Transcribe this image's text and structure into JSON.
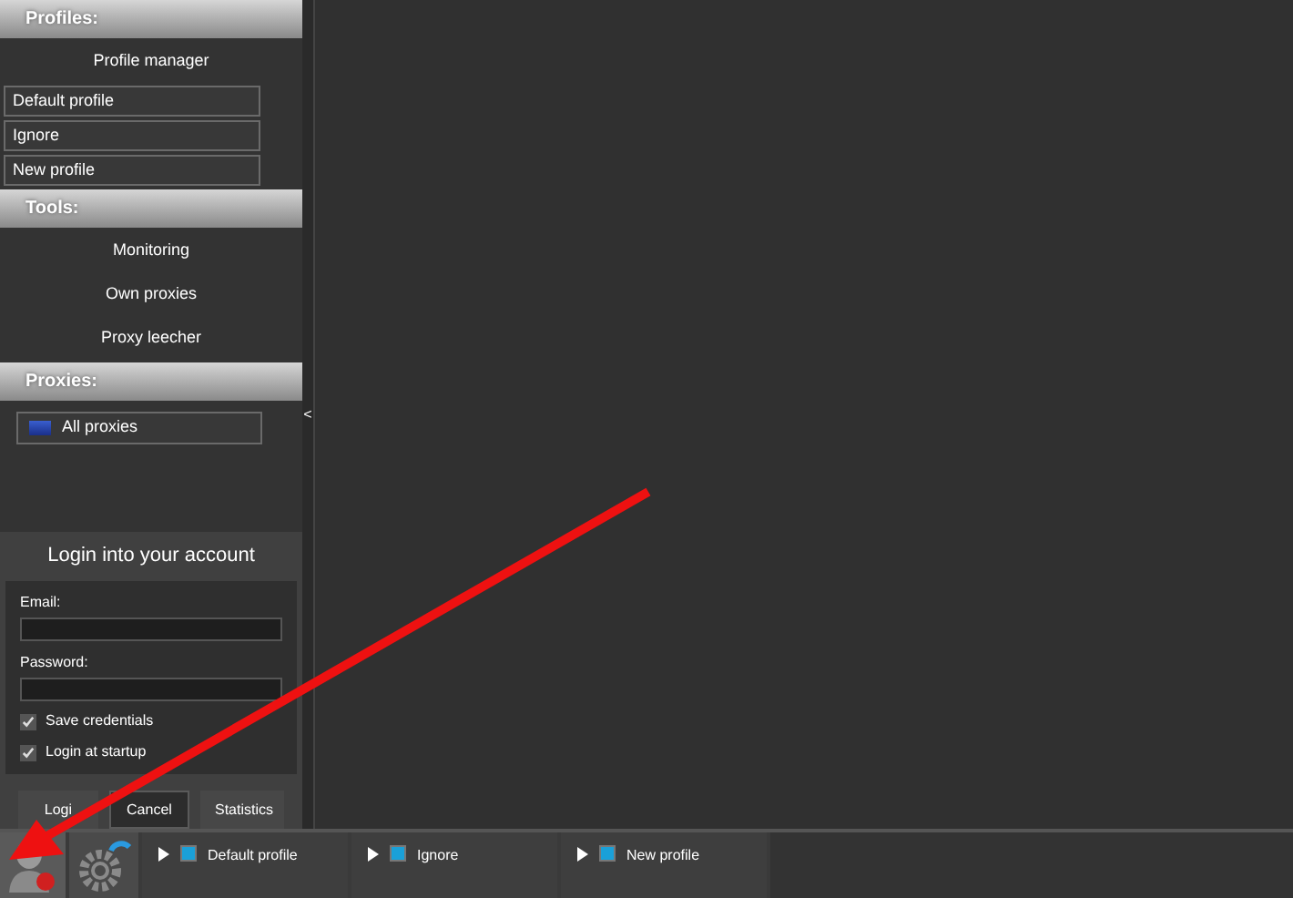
{
  "sidebar": {
    "sections": [
      {
        "title": "Profiles:",
        "items": [
          {
            "kind": "action",
            "label": "Profile manager"
          },
          {
            "kind": "entry",
            "label": "Default profile"
          },
          {
            "kind": "entry",
            "label": "Ignore"
          },
          {
            "kind": "entry",
            "label": "New profile"
          }
        ]
      },
      {
        "title": "Tools:",
        "items": [
          {
            "kind": "action",
            "label": "Monitoring"
          },
          {
            "kind": "action",
            "label": "Own proxies"
          },
          {
            "kind": "action",
            "label": "Proxy leecher"
          }
        ]
      },
      {
        "title": "Proxies:",
        "items": [
          {
            "kind": "flag-entry",
            "label": "All proxies"
          }
        ]
      }
    ],
    "collapse_glyph": "<"
  },
  "login": {
    "title": "Login into your account",
    "email_label": "Email:",
    "password_label": "Password:",
    "options": [
      {
        "label": "Save credentials",
        "checked": true
      },
      {
        "label": "Login at startup",
        "checked": true
      }
    ],
    "buttons": [
      "Logi",
      "Cancel",
      "Statistics"
    ]
  },
  "taskbar": {
    "tabs": [
      {
        "label": "Default profile"
      },
      {
        "label": "Ignore"
      },
      {
        "label": "New profile"
      }
    ]
  }
}
